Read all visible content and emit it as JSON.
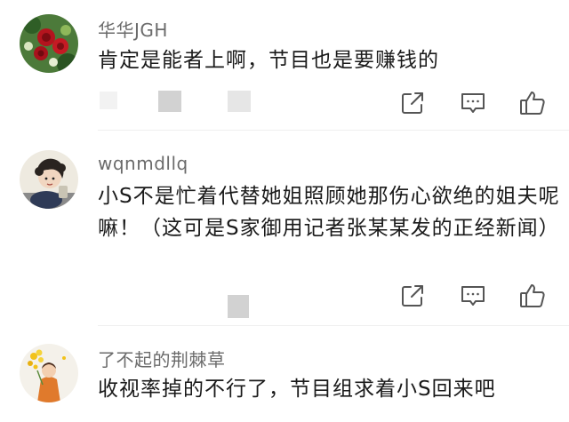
{
  "comments": [
    {
      "username": "华华JGH",
      "text": "肯定是能者上啊，节目也是要赚钱的",
      "avatar": "avatar-roses"
    },
    {
      "username": "wqnmdllq",
      "text": "小S不是忙着代替她姐照顾她那伤心欲绝的姐夫呢嘛！（这可是S家御用记者张某某发的正经新闻）",
      "avatar": "avatar-cartoon-girl"
    },
    {
      "username": "了不起的荆棘草",
      "text": "收视率掉的不行了，节目组求着小S回来吧",
      "avatar": "avatar-flower-girl"
    }
  ],
  "icons": {
    "share": "share-icon",
    "reply": "comment-icon",
    "like": "thumbs-up-icon"
  },
  "colors": {
    "username": "#6b6b6b",
    "text": "#1a1a1a",
    "icon": "#555555"
  }
}
